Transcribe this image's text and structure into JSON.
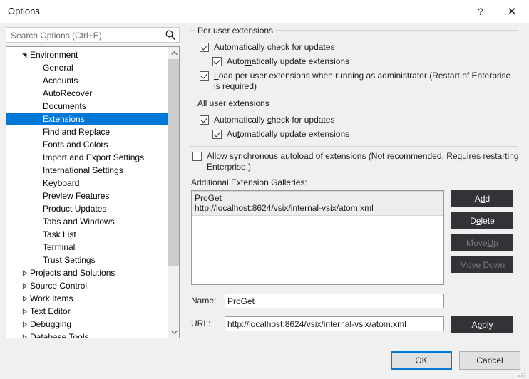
{
  "window": {
    "title": "Options",
    "help_icon": "question-mark-icon",
    "close_icon": "close-x-icon"
  },
  "search": {
    "placeholder": "Search Options (Ctrl+E)",
    "value": "",
    "icon": "search-magnifier-icon"
  },
  "tree": {
    "items": [
      {
        "label": "Environment",
        "level": 0,
        "expanded": true,
        "selected": false
      },
      {
        "label": "General",
        "level": 1,
        "expanded": null,
        "selected": false
      },
      {
        "label": "Accounts",
        "level": 1,
        "expanded": null,
        "selected": false
      },
      {
        "label": "AutoRecover",
        "level": 1,
        "expanded": null,
        "selected": false
      },
      {
        "label": "Documents",
        "level": 1,
        "expanded": null,
        "selected": false
      },
      {
        "label": "Extensions",
        "level": 1,
        "expanded": null,
        "selected": true
      },
      {
        "label": "Find and Replace",
        "level": 1,
        "expanded": null,
        "selected": false
      },
      {
        "label": "Fonts and Colors",
        "level": 1,
        "expanded": null,
        "selected": false
      },
      {
        "label": "Import and Export Settings",
        "level": 1,
        "expanded": null,
        "selected": false
      },
      {
        "label": "International Settings",
        "level": 1,
        "expanded": null,
        "selected": false
      },
      {
        "label": "Keyboard",
        "level": 1,
        "expanded": null,
        "selected": false
      },
      {
        "label": "Preview Features",
        "level": 1,
        "expanded": null,
        "selected": false
      },
      {
        "label": "Product Updates",
        "level": 1,
        "expanded": null,
        "selected": false
      },
      {
        "label": "Tabs and Windows",
        "level": 1,
        "expanded": null,
        "selected": false
      },
      {
        "label": "Task List",
        "level": 1,
        "expanded": null,
        "selected": false
      },
      {
        "label": "Terminal",
        "level": 1,
        "expanded": null,
        "selected": false
      },
      {
        "label": "Trust Settings",
        "level": 1,
        "expanded": null,
        "selected": false
      },
      {
        "label": "Projects and Solutions",
        "level": 0,
        "expanded": false,
        "selected": false
      },
      {
        "label": "Source Control",
        "level": 0,
        "expanded": false,
        "selected": false
      },
      {
        "label": "Work Items",
        "level": 0,
        "expanded": false,
        "selected": false
      },
      {
        "label": "Text Editor",
        "level": 0,
        "expanded": false,
        "selected": false
      },
      {
        "label": "Debugging",
        "level": 0,
        "expanded": false,
        "selected": false
      },
      {
        "label": "Database Tools",
        "level": 0,
        "expanded": false,
        "selected": false
      }
    ],
    "scroll_up_icon": "chevron-up-icon",
    "scroll_down_icon": "chevron-down-icon"
  },
  "per_user": {
    "legend": "Per user extensions",
    "check_updates": {
      "label_pre": "",
      "accel": "A",
      "label_post": "utomatically check for updates",
      "checked": true
    },
    "auto_update": {
      "label_pre": "Auto",
      "accel": "m",
      "label_post": "atically update extensions",
      "checked": true
    },
    "load_admin": {
      "label_pre": "",
      "accel": "L",
      "label_post": "oad per user extensions when running as administrator (Restart of Enterprise is required)",
      "checked": true
    }
  },
  "all_user": {
    "legend": "All user extensions",
    "check_updates": {
      "label_pre": "Automatically ",
      "accel": "c",
      "label_post": "heck for updates",
      "checked": true
    },
    "auto_update": {
      "label_pre": "Au",
      "accel": "t",
      "label_post": "omatically update extensions",
      "checked": true
    }
  },
  "allow_sync": {
    "label_pre": "Allow ",
    "accel": "s",
    "label_post": "ynchronous autoload of extensions (Not recommended. Requires restarting Enterprise.)",
    "checked": false
  },
  "galleries": {
    "label": "Additional Extension Galleries:",
    "items": [
      {
        "name": "ProGet",
        "url": "http://localhost:8624/vsix/internal-vsix/atom.xml",
        "selected": true
      }
    ],
    "buttons": [
      {
        "pre": "A",
        "accel": "d",
        "post": "d",
        "enabled": true,
        "name": "add-gallery-button"
      },
      {
        "pre": "D",
        "accel": "e",
        "post": "lete",
        "enabled": true,
        "name": "delete-gallery-button"
      },
      {
        "pre": "Move ",
        "accel": "U",
        "post": "p",
        "enabled": false,
        "name": "move-up-button"
      },
      {
        "pre": "Move D",
        "accel": "o",
        "post": "wn",
        "enabled": false,
        "name": "move-down-button"
      }
    ]
  },
  "fields": {
    "name_label": "Name:",
    "name_value": "ProGet",
    "url_label": "URL:",
    "url_value": "http://localhost:8624/vsix/internal-vsix/atom.xml",
    "apply": {
      "pre": "A",
      "accel": "p",
      "post": "ply"
    }
  },
  "footer": {
    "ok": "OK",
    "cancel": "Cancel"
  },
  "colors": {
    "accent": "#0078d7",
    "dialog_bg": "#f0f0f0",
    "dark_button": "#333337",
    "selection": "#0078d7"
  }
}
